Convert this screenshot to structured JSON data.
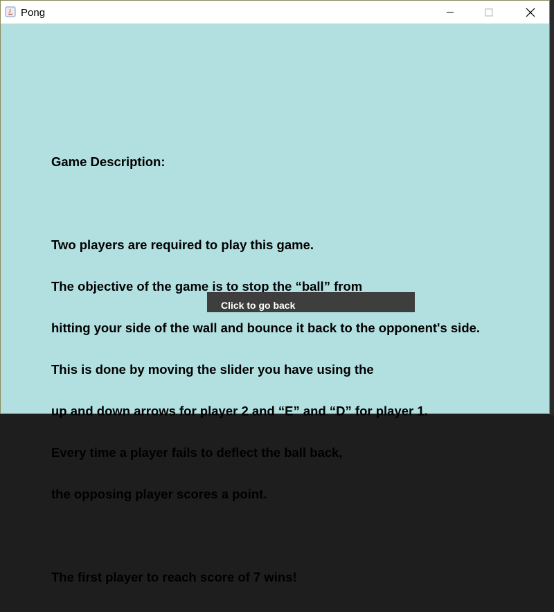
{
  "window": {
    "title": "Pong",
    "background": "#b2dfe0",
    "controls": {
      "minimize_icon": "minimize-icon",
      "maximize_icon": "maximize-icon",
      "close_icon": "close-icon"
    }
  },
  "description": {
    "heading": "Game Description:",
    "lines": [
      "Two players are required to play this game.",
      "The objective of the game is to stop the “ball” from",
      "hitting your side of the wall and bounce it back to the opponent's side.",
      "This is done by moving the slider you have using the",
      "up and down arrows for player 2 and “E” and “D” for player 1.",
      "Every time a player fails to deflect the ball back,",
      "the opposing player scores a point."
    ],
    "win_condition": "The first player to reach score of 7 wins!"
  },
  "back_button": {
    "label": "Click to go back",
    "color": "#3e3e3e"
  }
}
